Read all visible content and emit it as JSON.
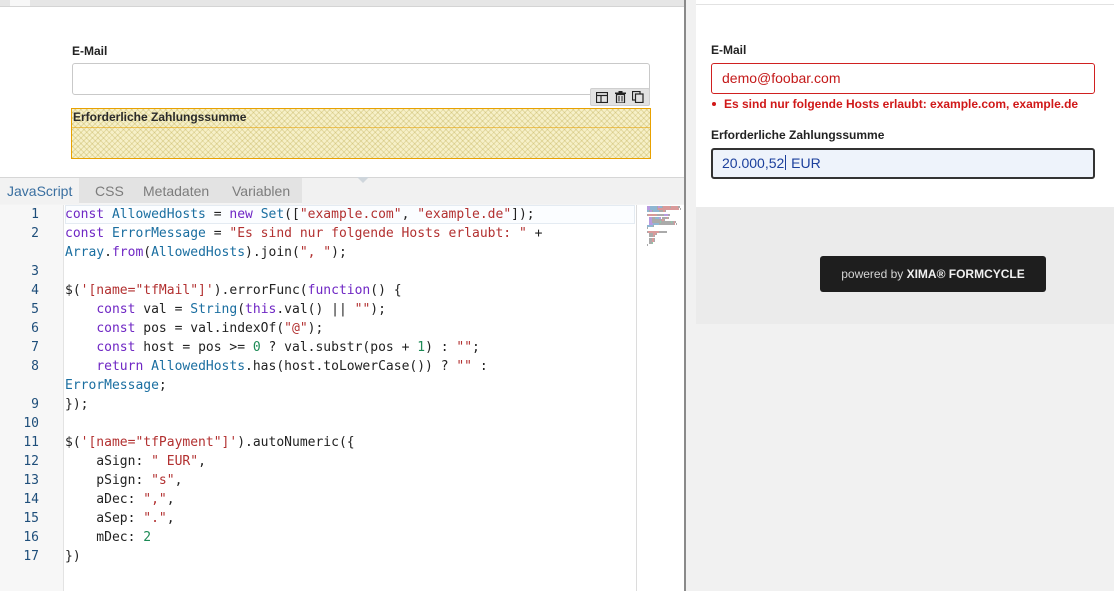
{
  "designer": {
    "email_label": "E-Mail",
    "payment_label": "Erforderliche Zahlungssumme",
    "toolbar_icons": [
      "layout-icon",
      "trash-icon",
      "copy-icon"
    ]
  },
  "editor": {
    "tabs": [
      {
        "label": "JavaScript",
        "active": true
      },
      {
        "label": "CSS",
        "active": false
      },
      {
        "label": "Metadaten",
        "active": false
      },
      {
        "label": "Variablen",
        "active": false
      }
    ],
    "line_numbers": [
      "1",
      "2",
      "",
      "3",
      "4",
      "5",
      "6",
      "7",
      "8",
      "",
      "9",
      "10",
      "11",
      "12",
      "13",
      "14",
      "15",
      "16",
      "17"
    ],
    "code_lines": [
      [
        [
          "kw",
          "const "
        ],
        [
          "def",
          "AllowedHosts"
        ],
        [
          "plain",
          " = "
        ],
        [
          "kw",
          "new "
        ],
        [
          "def",
          "Set"
        ],
        [
          "plain",
          "(["
        ],
        [
          "str",
          "\"example.com\""
        ],
        [
          "plain",
          ", "
        ],
        [
          "str",
          "\"example.de\""
        ],
        [
          "plain",
          "]);"
        ]
      ],
      [
        [
          "kw",
          "const "
        ],
        [
          "def",
          "ErrorMessage"
        ],
        [
          "plain",
          " = "
        ],
        [
          "str",
          "\"Es sind nur folgende Hosts erlaubt: \""
        ],
        [
          "plain",
          " +"
        ]
      ],
      [
        [
          "def",
          "Array"
        ],
        [
          "plain",
          "."
        ],
        [
          "kw",
          "from"
        ],
        [
          "plain",
          "("
        ],
        [
          "def",
          "AllowedHosts"
        ],
        [
          "plain",
          ").join("
        ],
        [
          "str",
          "\", \""
        ],
        [
          "plain",
          ");"
        ]
      ],
      [],
      [
        [
          "plain",
          "$("
        ],
        [
          "str",
          "'[name=\"tfMail\"]'"
        ],
        [
          "plain",
          ").errorFunc("
        ],
        [
          "kw",
          "function"
        ],
        [
          "plain",
          "() {"
        ]
      ],
      [
        [
          "plain",
          "    "
        ],
        [
          "kw",
          "const "
        ],
        [
          "plain",
          "val = "
        ],
        [
          "def",
          "String"
        ],
        [
          "plain",
          "("
        ],
        [
          "kw",
          "this"
        ],
        [
          "plain",
          ".val() || "
        ],
        [
          "str",
          "\"\""
        ],
        [
          "plain",
          ");"
        ]
      ],
      [
        [
          "plain",
          "    "
        ],
        [
          "kw",
          "const "
        ],
        [
          "plain",
          "pos = val.indexOf("
        ],
        [
          "str",
          "\"@\""
        ],
        [
          "plain",
          ");"
        ]
      ],
      [
        [
          "plain",
          "    "
        ],
        [
          "kw",
          "const "
        ],
        [
          "plain",
          "host = pos >= "
        ],
        [
          "num",
          "0"
        ],
        [
          "plain",
          " ? val.substr(pos + "
        ],
        [
          "num",
          "1"
        ],
        [
          "plain",
          ") : "
        ],
        [
          "str",
          "\"\""
        ],
        [
          "plain",
          ";"
        ]
      ],
      [
        [
          "plain",
          "    "
        ],
        [
          "kw",
          "return "
        ],
        [
          "def",
          "AllowedHosts"
        ],
        [
          "plain",
          ".has(host.toLowerCase()) ? "
        ],
        [
          "str",
          "\"\""
        ],
        [
          "plain",
          " :"
        ]
      ],
      [
        [
          "def",
          "ErrorMessage"
        ],
        [
          "plain",
          ";"
        ]
      ],
      [
        [
          "plain",
          "});"
        ]
      ],
      [],
      [
        [
          "plain",
          "$("
        ],
        [
          "str",
          "'[name=\"tfPayment\"]'"
        ],
        [
          "plain",
          ").autoNumeric({"
        ]
      ],
      [
        [
          "plain",
          "    aSign: "
        ],
        [
          "str",
          "\" EUR\""
        ],
        [
          "plain",
          ","
        ]
      ],
      [
        [
          "plain",
          "    pSign: "
        ],
        [
          "str",
          "\"s\""
        ],
        [
          "plain",
          ","
        ]
      ],
      [
        [
          "plain",
          "    aDec: "
        ],
        [
          "str",
          "\",\""
        ],
        [
          "plain",
          ","
        ]
      ],
      [
        [
          "plain",
          "    aSep: "
        ],
        [
          "str",
          "\".\""
        ],
        [
          "plain",
          ","
        ]
      ],
      [
        [
          "plain",
          "    mDec: "
        ],
        [
          "num",
          "2"
        ]
      ],
      [
        [
          "plain",
          "})"
        ]
      ]
    ]
  },
  "preview": {
    "email_label": "E-Mail",
    "email_value": "demo@foobar.com",
    "email_error": "Es sind nur folgende Hosts erlaubt: example.com, example.de",
    "payment_label": "Erforderliche Zahlungssumme",
    "payment_value_before_caret": "20.000,52",
    "payment_value_after_caret": " EUR",
    "powered_prefix": "powered by ",
    "powered_brand": "XIMA® FORMCYCLE"
  },
  "colors": {
    "error": "#d01818",
    "selection_border": "#e8a100",
    "tab_active": "#3a6fa0"
  }
}
